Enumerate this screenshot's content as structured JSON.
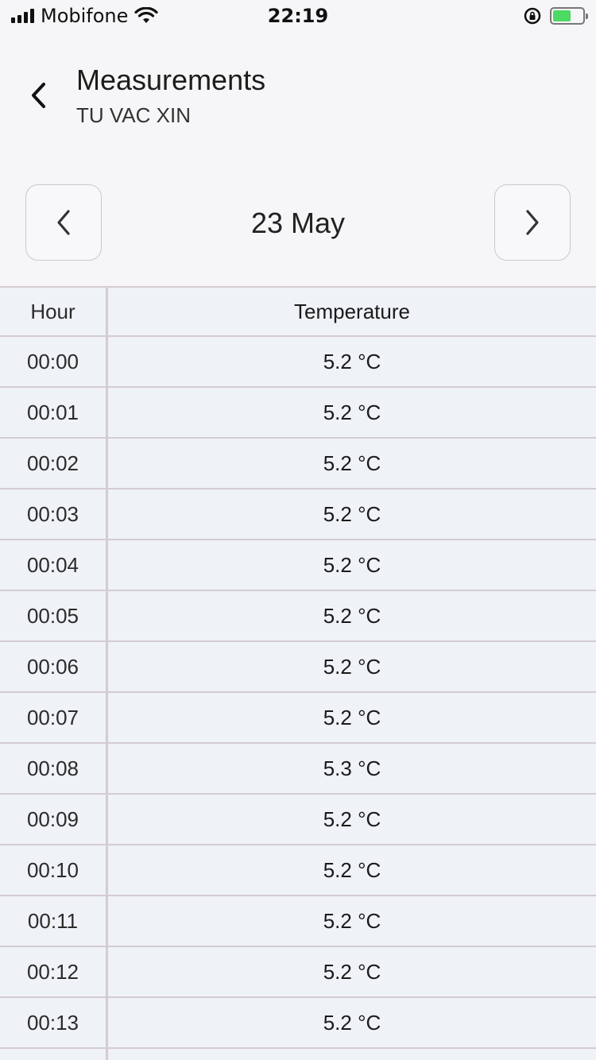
{
  "status": {
    "carrier": "Mobifone",
    "time": "22:19",
    "icons": [
      "signal-icon",
      "wifi-icon",
      "rotation-lock-icon",
      "battery-charging-icon"
    ]
  },
  "header": {
    "title": "Measurements",
    "subtitle": "TU VAC XIN",
    "back_icon": "chevron-left-icon"
  },
  "date_nav": {
    "date": "23 May",
    "prev_icon": "chevron-left-icon",
    "next_icon": "chevron-right-icon"
  },
  "table": {
    "columns": [
      "Hour",
      "Temperature"
    ],
    "rows": [
      {
        "hour": "00:00",
        "temperature": "5.2 °C"
      },
      {
        "hour": "00:01",
        "temperature": "5.2 °C"
      },
      {
        "hour": "00:02",
        "temperature": "5.2 °C"
      },
      {
        "hour": "00:03",
        "temperature": "5.2 °C"
      },
      {
        "hour": "00:04",
        "temperature": "5.2 °C"
      },
      {
        "hour": "00:05",
        "temperature": "5.2 °C"
      },
      {
        "hour": "00:06",
        "temperature": "5.2 °C"
      },
      {
        "hour": "00:07",
        "temperature": "5.2 °C"
      },
      {
        "hour": "00:08",
        "temperature": "5.3 °C"
      },
      {
        "hour": "00:09",
        "temperature": "5.2 °C"
      },
      {
        "hour": "00:10",
        "temperature": "5.2 °C"
      },
      {
        "hour": "00:11",
        "temperature": "5.2 °C"
      },
      {
        "hour": "00:12",
        "temperature": "5.2 °C"
      },
      {
        "hour": "00:13",
        "temperature": "5.2 °C"
      }
    ]
  },
  "colors": {
    "background": "#f6f6f8",
    "table_background": "#eff2f6",
    "divider": "#d4ccd2",
    "battery": "#4cd964"
  }
}
